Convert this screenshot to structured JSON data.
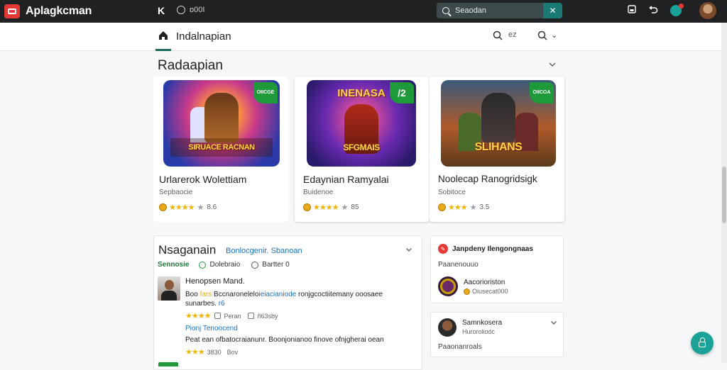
{
  "topbar": {
    "app_name": "Aplagkcman",
    "k_label": "K",
    "status_text": "ɒ00I",
    "search_placeholder": "Seaodan",
    "search_btn": "✕",
    "icons": [
      "brand-icon",
      "k-icon",
      "status-icon",
      "search-icon",
      "save-icon",
      "refresh-icon",
      "notification-icon",
      "avatar"
    ]
  },
  "subbar": {
    "title": "Indalnapian",
    "search_label": "ez",
    "sort_label": "⌄"
  },
  "section": {
    "title": "Radaapian"
  },
  "cards": [
    {
      "title": "Urlarerok Wolettiam",
      "subtitle": "Sepbaocie",
      "rating_text": "8.6",
      "logo": "SIRUACE RACNAN",
      "corner": "OIICGE"
    },
    {
      "title": "Edaynian Ramyalai",
      "subtitle": "Buidenoe",
      "rating_text": "85",
      "logo": "SFGMAIS",
      "banner": "INENASA",
      "corner": "/2"
    },
    {
      "title": "Noolecap Ranogridsigk",
      "subtitle": "Sobitoce",
      "rating_text": "3.5",
      "logo": "SLIHANS",
      "corner": "OIICOA"
    }
  ],
  "review_panel": {
    "title": "Nsaganain",
    "link": "Bonlocgenir. Sbanoan",
    "tags": [
      "Sennosie",
      "Dolebraio",
      "Bartter 0"
    ],
    "review": {
      "name": "Henopsen Mand.",
      "text_a": "Boo ",
      "text_hl1": "fars ",
      "text_b": "Bccnaronelelo",
      "text_hl2": "ieiacianiode ",
      "text_c": "ronjgcoctiitemany ooosaee ",
      "text_d": "sunarbes. ",
      "text_hl3": "r6",
      "meta_a": "Peran",
      "meta_b": "ñ63sby"
    },
    "reply": {
      "title": "Pionj Tenoocend",
      "text": "Peat ean ofbatocraianunr. Boonjonianoo finove ofnjgherai oean",
      "meta_a": "3830",
      "meta_b": "Bov"
    }
  },
  "side_cards": {
    "card1": {
      "header": "Janpdeny Ilengongnaas",
      "subtitle": "Paanenouuo",
      "game_name": "Aacorioriston",
      "game_meta": "Oiusecat000"
    },
    "card2": {
      "name": "Samnkosera",
      "meta": "Hurorolioóc",
      "footer": "Paaonanroals"
    }
  },
  "colors": {
    "topbar": "#1f2123",
    "accent_teal": "#1aa198",
    "brand_red": "#e53935",
    "link_blue": "#1a73c0",
    "green": "#1e9a3a",
    "star": "#f4b400"
  }
}
